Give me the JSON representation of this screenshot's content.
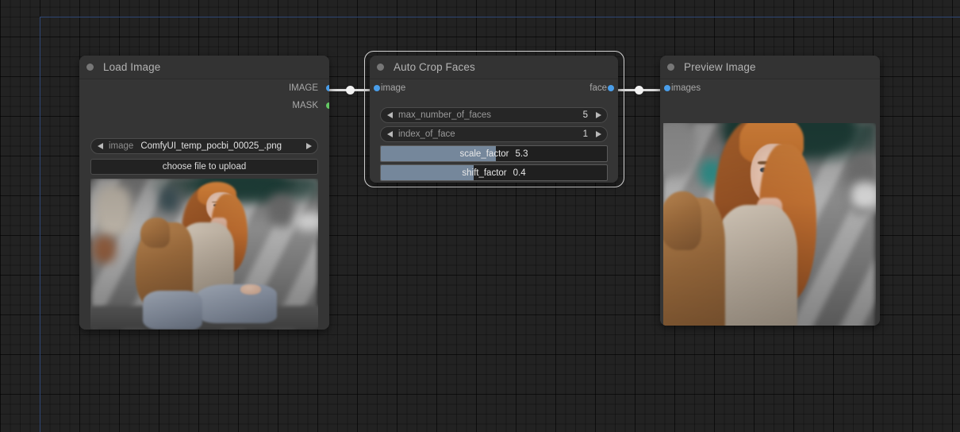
{
  "app": {
    "canvas_bg": "#222222",
    "grid_minor": "12.5px",
    "grid_major": "50px",
    "guide_color": "#2e4674",
    "link_color": "#dcdcdc"
  },
  "nodes": [
    {
      "id": "load-image",
      "title": "Load Image",
      "collapse_dot": "collapse-dot-icon",
      "outputs": [
        {
          "label": "IMAGE",
          "color": "#4a9eea",
          "type": "IMAGE"
        },
        {
          "label": "MASK",
          "color": "#63c763",
          "type": "MASK"
        }
      ],
      "inputs": [],
      "widgets": [
        {
          "kind": "combo",
          "name": "image",
          "value": "ComfyUI_temp_pocbi_00025_.png",
          "left_arrow": "chevron-left-icon",
          "right_arrow": "chevron-right-icon"
        },
        {
          "kind": "button",
          "label": "choose file to upload"
        }
      ],
      "preview": {
        "alt": "blurred street photo of a red-haired woman sitting on a curb"
      }
    },
    {
      "id": "auto-crop-faces",
      "title": "Auto Crop Faces",
      "collapse_dot": "collapse-dot-icon",
      "selected": true,
      "inputs": [
        {
          "label": "image",
          "color": "#4a9eea",
          "type": "IMAGE"
        }
      ],
      "outputs": [
        {
          "label": "face",
          "color": "#4a9eea",
          "type": "IMAGE"
        }
      ],
      "widgets": [
        {
          "kind": "number",
          "name": "max_number_of_faces",
          "value": "5",
          "left_arrow": "chevron-left-icon",
          "right_arrow": "chevron-right-icon"
        },
        {
          "kind": "number",
          "name": "index_of_face",
          "value": "1",
          "left_arrow": "chevron-left-icon",
          "right_arrow": "chevron-right-icon"
        },
        {
          "kind": "slider",
          "name": "scale_factor",
          "value": "5.3",
          "fill_percent": 51,
          "fill_color": "#75879b"
        },
        {
          "kind": "slider",
          "name": "shift_factor",
          "value": "0.4",
          "fill_percent": 41,
          "fill_color": "#75879b"
        }
      ]
    },
    {
      "id": "preview-image",
      "title": "Preview Image",
      "collapse_dot": "collapse-dot-icon",
      "inputs": [
        {
          "label": "images",
          "color": "#4a9eea",
          "type": "IMAGE"
        }
      ],
      "outputs": [],
      "widgets": [],
      "preview": {
        "alt": "cropped close-up of the red-haired woman's face and torso"
      }
    }
  ],
  "links": [
    {
      "from": "load-image.IMAGE",
      "to": "auto-crop-faces.image",
      "color": "#dcdcdc"
    },
    {
      "from": "auto-crop-faces.face",
      "to": "preview-image.images",
      "color": "#dcdcdc"
    }
  ]
}
